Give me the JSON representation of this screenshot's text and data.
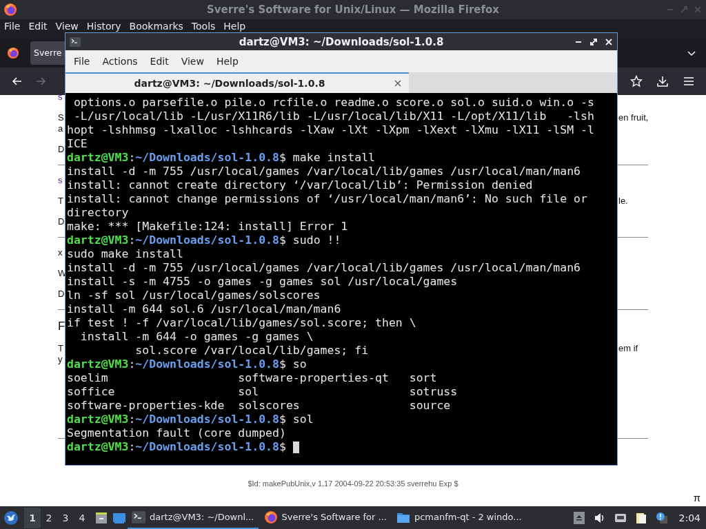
{
  "firefox": {
    "title": "Sverre's Software for Unix/Linux — Mozilla Firefox",
    "menu": [
      "File",
      "Edit",
      "View",
      "History",
      "Bookmarks",
      "Tools",
      "Help"
    ],
    "tabs": [
      {
        "label": "Sverre",
        "selected": true
      }
    ],
    "page": {
      "blocks": [
        {
          "kind": "link",
          "lines": [
            {
              "left": "s"
            }
          ]
        },
        {
          "kind": "para",
          "lines": [
            {
              "left": "S",
              "right": "en fruit,"
            },
            {
              "left": "a"
            }
          ]
        },
        {
          "kind": "para",
          "lines": [
            {
              "left": "D"
            }
          ]
        },
        {
          "kind": "rule"
        },
        {
          "kind": "link",
          "lines": [
            {
              "left": "s"
            }
          ]
        },
        {
          "kind": "para",
          "lines": [
            {
              "left": "T",
              "right": "le."
            }
          ]
        },
        {
          "kind": "para",
          "lines": [
            {
              "left": "D"
            }
          ]
        },
        {
          "kind": "rule"
        },
        {
          "kind": "para",
          "lines": [
            {
              "left": "x"
            }
          ]
        },
        {
          "kind": "para",
          "lines": [
            {
              "left": "W"
            }
          ]
        },
        {
          "kind": "para",
          "lines": [
            {
              "left": "D"
            }
          ]
        },
        {
          "kind": "rule"
        },
        {
          "kind": "heading",
          "lines": [
            {
              "left": "F"
            }
          ]
        },
        {
          "kind": "para",
          "lines": [
            {
              "left": "T",
              "right": "em if"
            },
            {
              "left": "y"
            }
          ]
        },
        {
          "kind": "rule"
        }
      ],
      "footer": "$Id: makePubUnix,v 1.17 2004-09-22 20:53:35 sverrehu Exp $",
      "corner": "π"
    }
  },
  "terminal": {
    "title": "dartz@VM3: ~/Downloads/sol-1.0.8",
    "menu": [
      "File",
      "Actions",
      "Edit",
      "View",
      "Help"
    ],
    "tabs": [
      {
        "label": "dartz@VM3: ~/Downloads/sol-1.0.8",
        "selected": true
      }
    ],
    "lines": [
      {
        "kind": "output",
        "text": " options.o parsefile.o pile.o rcfile.o readme.o score.o sol.o suid.o win.o -s"
      },
      {
        "kind": "output",
        "text": " -L/usr/local/lib -L/usr/X11R6/lib -L/usr/local/lib/X11 -L/opt/X11/lib   -lsh"
      },
      {
        "kind": "output",
        "text": "hopt -lshhmsg -lxalloc -lshhcards -lXaw -lXt -lXpm -lXext -lXmu -lX11 -lSM -l"
      },
      {
        "kind": "output",
        "text": "ICE"
      },
      {
        "kind": "prompt",
        "user": "dartz@VM3",
        "sep": ":",
        "path": "~/Downloads/sol-1.0.8",
        "rest": "$ make install"
      },
      {
        "kind": "output",
        "text": "install -d -m 755 /usr/local/games /var/local/lib/games /usr/local/man/man6"
      },
      {
        "kind": "output",
        "text": "install: cannot create directory ‘/var/local/lib’: Permission denied"
      },
      {
        "kind": "output",
        "text": "install: cannot change permissions of ‘/usr/local/man/man6’: No such file or"
      },
      {
        "kind": "output",
        "text": "directory"
      },
      {
        "kind": "output",
        "text": "make: *** [Makefile:124: install] Error 1"
      },
      {
        "kind": "prompt",
        "user": "dartz@VM3",
        "sep": ":",
        "path": "~/Downloads/sol-1.0.8",
        "rest": "$ sudo !!"
      },
      {
        "kind": "output",
        "text": "sudo make install"
      },
      {
        "kind": "output",
        "text": "install -d -m 755 /usr/local/games /var/local/lib/games /usr/local/man/man6"
      },
      {
        "kind": "output",
        "text": "install -s -m 4755 -o games -g games sol /usr/local/games"
      },
      {
        "kind": "output",
        "text": "ln -sf sol /usr/local/games/solscores"
      },
      {
        "kind": "output",
        "text": "install -m 644 sol.6 /usr/local/man/man6"
      },
      {
        "kind": "output",
        "text": "if test ! -f /var/local/lib/games/sol.score; then \\"
      },
      {
        "kind": "output",
        "text": "  install -m 644 -o games -g games \\"
      },
      {
        "kind": "output",
        "text": "          sol.score /var/local/lib/games; fi"
      },
      {
        "kind": "prompt",
        "user": "dartz@VM3",
        "sep": ":",
        "path": "~/Downloads/sol-1.0.8",
        "rest": "$ so"
      },
      {
        "kind": "output",
        "text": "soelim                   software-properties-qt   sort"
      },
      {
        "kind": "output",
        "text": "soffice                  sol                      sotruss"
      },
      {
        "kind": "output",
        "text": "software-properties-kde  solscores                source"
      },
      {
        "kind": "prompt",
        "user": "dartz@VM3",
        "sep": ":",
        "path": "~/Downloads/sol-1.0.8",
        "rest": "$ sol"
      },
      {
        "kind": "output",
        "text": "Segmentation fault (core dumped)"
      },
      {
        "kind": "prompt",
        "user": "dartz@VM3",
        "sep": ":",
        "path": "~/Downloads/sol-1.0.8",
        "rest": "$",
        "cursor": true
      }
    ]
  },
  "taskbar": {
    "desktops": [
      {
        "label": "1",
        "selected": true
      },
      {
        "label": "2",
        "selected": false
      },
      {
        "label": "3",
        "selected": false
      },
      {
        "label": "4",
        "selected": false
      }
    ],
    "tasks": [
      {
        "kind": "terminal",
        "label": "dartz@VM3: ~/Downl...",
        "selected": true
      },
      {
        "kind": "browser",
        "label": "Sverre's Software for ...",
        "selected": false
      },
      {
        "kind": "folder",
        "label": "pcmanfm-qt - 2 windo...",
        "selected": false
      }
    ],
    "clock": "2:04"
  }
}
